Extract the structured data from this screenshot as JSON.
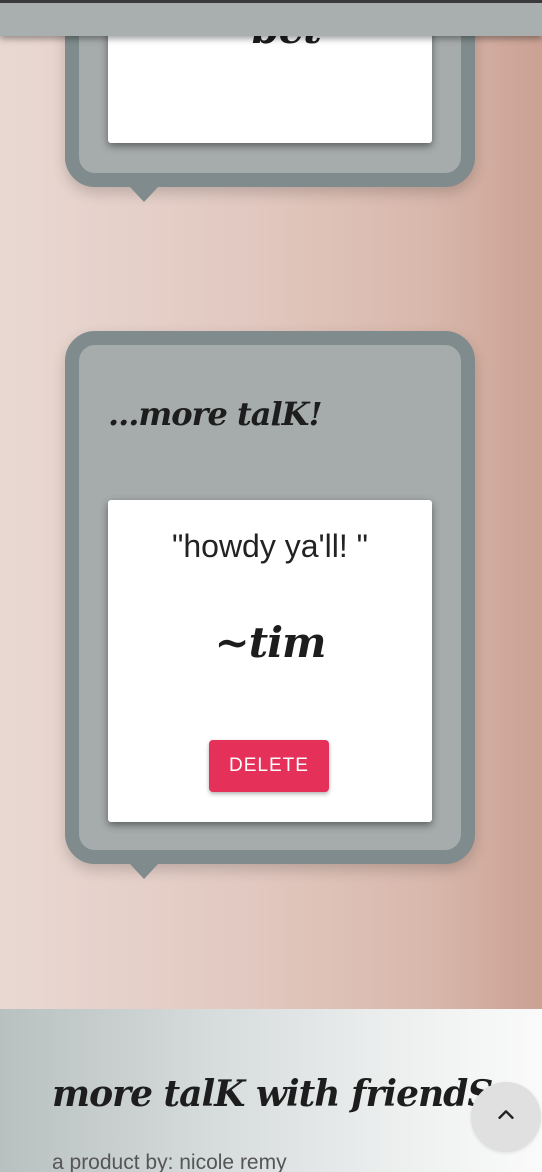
{
  "posts": [
    {
      "author": "~bet"
    },
    {
      "title": "...more talK!",
      "quote": "\"howdy ya'll! \"",
      "author": "~tim",
      "delete_label": "DELETE"
    }
  ],
  "footer": {
    "title": "more talK with friendS",
    "credit": "a product by: nicole remy"
  },
  "icons": {
    "scroll_top": "chevron-up-icon"
  },
  "colors": {
    "delete_button": "#e5305a",
    "bubble_border": "#7f8b8c",
    "bubble_fill": "#a6abab"
  }
}
